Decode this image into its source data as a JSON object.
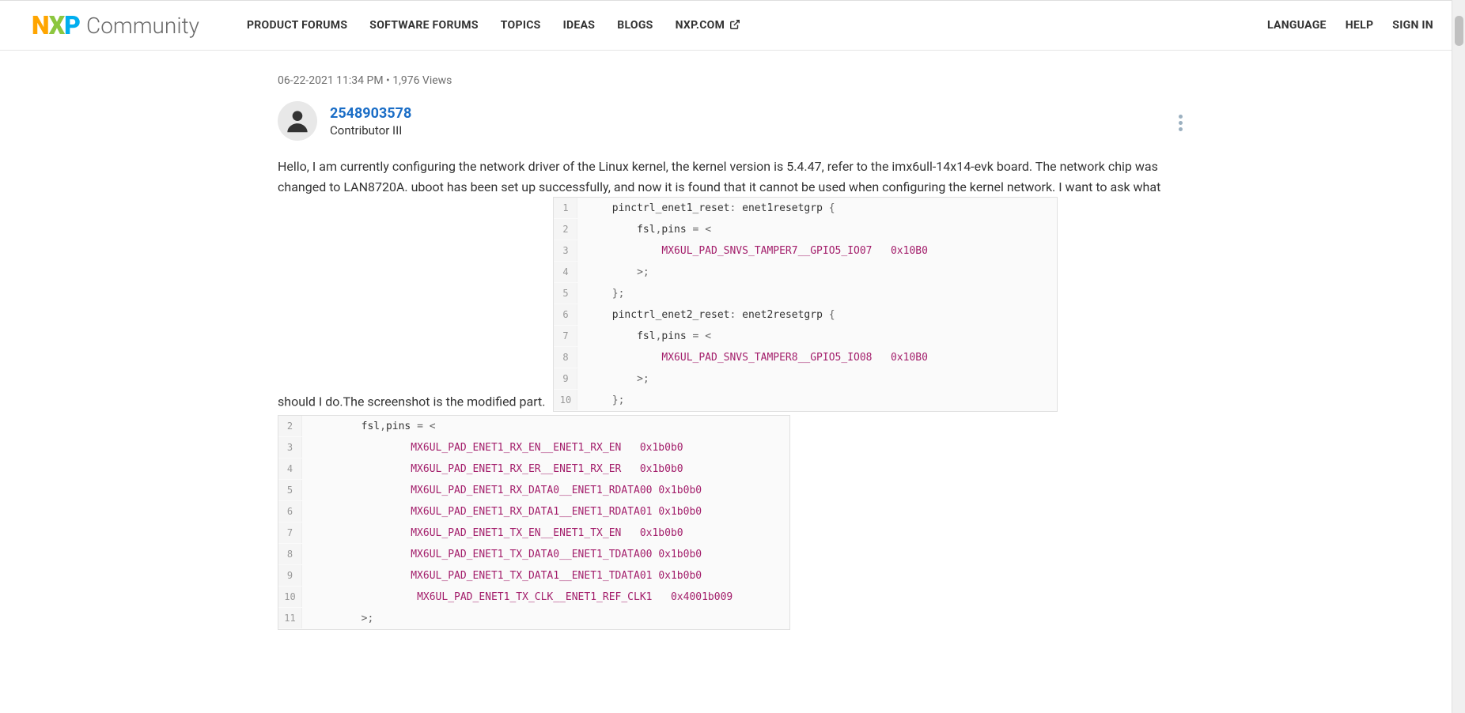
{
  "header": {
    "logo": {
      "n": "N",
      "x": "X",
      "p": "P",
      "community": "Community"
    },
    "nav": [
      {
        "label": "PRODUCT FORUMS"
      },
      {
        "label": "SOFTWARE FORUMS"
      },
      {
        "label": "TOPICS"
      },
      {
        "label": "IDEAS"
      },
      {
        "label": "BLOGS"
      },
      {
        "label": "NXP.COM",
        "external": true
      }
    ],
    "right_nav": [
      {
        "label": "LANGUAGE"
      },
      {
        "label": "HELP"
      },
      {
        "label": "SIGN IN"
      }
    ]
  },
  "post": {
    "meta_date": "06-22-2021 11:34 PM",
    "meta_sep": " • ",
    "meta_views": "1,976 Views",
    "author": {
      "name": "2548903578",
      "rank": "Contributor III"
    },
    "body_part1": "Hello, I am currently configuring the network driver of the Linux kernel, the kernel version is 5.4.47, refer to the imx6ull-14x14-evk board. The network chip was changed to LAN8720A. uboot has been set up successfully, and now it is found that it cannot be used when configuring the kernel network. I want to ask what should I do.The screenshot is the modified part.",
    "code1": [
      {
        "n": "1",
        "indent": "    ",
        "pre": "pinctrl_enet1_reset",
        "punc1": ": ",
        "mid": "enet1resetgrp ",
        "punc2": "{"
      },
      {
        "n": "2",
        "indent": "        ",
        "pre": "fsl",
        "punc1": ",",
        "mid": "pins ",
        "punc2": "= <"
      },
      {
        "n": "3",
        "indent": "            ",
        "macro": "MX6UL_PAD_SNVS_TAMPER7__GPIO5_IO07",
        "sp": "   ",
        "hex": "0x10B0"
      },
      {
        "n": "4",
        "indent": "        ",
        "punc": ">;"
      },
      {
        "n": "5",
        "indent": "    ",
        "punc": "};"
      },
      {
        "n": "6",
        "indent": "    ",
        "pre": "pinctrl_enet2_reset",
        "punc1": ": ",
        "mid": "enet2resetgrp ",
        "punc2": "{"
      },
      {
        "n": "7",
        "indent": "        ",
        "pre": "fsl",
        "punc1": ",",
        "mid": "pins ",
        "punc2": "= <"
      },
      {
        "n": "8",
        "indent": "            ",
        "macro": "MX6UL_PAD_SNVS_TAMPER8__GPIO5_IO08",
        "sp": "   ",
        "hex": "0x10B0"
      },
      {
        "n": "9",
        "indent": "        ",
        "punc": ">;"
      },
      {
        "n": "10",
        "indent": "    ",
        "punc": "};"
      }
    ],
    "code2": [
      {
        "n": "2",
        "indent": "        ",
        "pre": "fsl",
        "punc1": ",",
        "mid": "pins ",
        "punc2": "= <"
      },
      {
        "n": "3",
        "indent": "                ",
        "macro": "MX6UL_PAD_ENET1_RX_EN__ENET1_RX_EN",
        "sp": "   ",
        "hex": "0x1b0b0"
      },
      {
        "n": "4",
        "indent": "                ",
        "macro": "MX6UL_PAD_ENET1_RX_ER__ENET1_RX_ER",
        "sp": "   ",
        "hex": "0x1b0b0"
      },
      {
        "n": "5",
        "indent": "                ",
        "macro": "MX6UL_PAD_ENET1_RX_DATA0__ENET1_RDATA00",
        "sp": " ",
        "hex": "0x1b0b0"
      },
      {
        "n": "6",
        "indent": "                ",
        "macro": "MX6UL_PAD_ENET1_RX_DATA1__ENET1_RDATA01",
        "sp": " ",
        "hex": "0x1b0b0"
      },
      {
        "n": "7",
        "indent": "                ",
        "macro": "MX6UL_PAD_ENET1_TX_EN__ENET1_TX_EN",
        "sp": "   ",
        "hex": "0x1b0b0"
      },
      {
        "n": "8",
        "indent": "                ",
        "macro": "MX6UL_PAD_ENET1_TX_DATA0__ENET1_TDATA00",
        "sp": " ",
        "hex": "0x1b0b0"
      },
      {
        "n": "9",
        "indent": "                ",
        "macro": "MX6UL_PAD_ENET1_TX_DATA1__ENET1_TDATA01",
        "sp": " ",
        "hex": "0x1b0b0"
      },
      {
        "n": "10",
        "indent": "                 ",
        "macro": "MX6UL_PAD_ENET1_TX_CLK__ENET1_REF_CLK1",
        "sp": "   ",
        "hex": "0x4001b009"
      },
      {
        "n": "11",
        "indent": "        ",
        "punc": ">;"
      }
    ]
  }
}
